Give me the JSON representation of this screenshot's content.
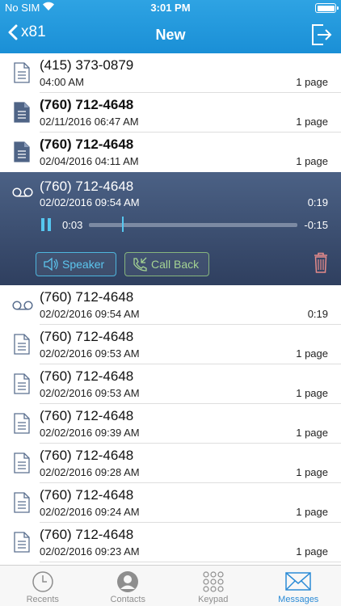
{
  "status": {
    "carrier": "No SIM",
    "time": "3:01 PM"
  },
  "nav": {
    "back_label": "x81",
    "title": "New"
  },
  "messages": [
    {
      "number": "(415) 373-0879",
      "date": "04:00 AM",
      "meta": "1 page",
      "type": "fax",
      "unread": false
    },
    {
      "number": "(760) 712-4648",
      "date": "02/11/2016 06:47 AM",
      "meta": "1 page",
      "type": "fax",
      "unread": true
    },
    {
      "number": "(760) 712-4648",
      "date": "02/04/2016 04:11 AM",
      "meta": "1 page",
      "type": "fax",
      "unread": true
    }
  ],
  "voicemail": {
    "number": "(760) 712-4648",
    "date": "02/02/2016 09:54 AM",
    "duration": "0:19",
    "elapsed": "0:03",
    "remaining": "-0:15",
    "progress": 0.16,
    "speaker_label": "Speaker",
    "callback_label": "Call Back"
  },
  "messages2": [
    {
      "number": "(760) 712-4648",
      "date": "02/02/2016 09:54 AM",
      "meta": "0:19",
      "type": "voicemail"
    },
    {
      "number": "(760) 712-4648",
      "date": "02/02/2016 09:53 AM",
      "meta": "1 page",
      "type": "fax"
    },
    {
      "number": "(760) 712-4648",
      "date": "02/02/2016 09:53 AM",
      "meta": "1 page",
      "type": "fax"
    },
    {
      "number": "(760) 712-4648",
      "date": "02/02/2016 09:39 AM",
      "meta": "1 page",
      "type": "fax"
    },
    {
      "number": "(760) 712-4648",
      "date": "02/02/2016 09:28 AM",
      "meta": "1 page",
      "type": "fax"
    },
    {
      "number": "(760) 712-4648",
      "date": "02/02/2016 09:24 AM",
      "meta": "1 page",
      "type": "fax"
    },
    {
      "number": "(760) 712-4648",
      "date": "02/02/2016 09:23 AM",
      "meta": "1 page",
      "type": "fax"
    }
  ],
  "tabs": [
    {
      "label": "Recents",
      "icon": "clock-icon",
      "active": false
    },
    {
      "label": "Contacts",
      "icon": "contact-icon",
      "active": false
    },
    {
      "label": "Keypad",
      "icon": "keypad-icon",
      "active": false
    },
    {
      "label": "Messages",
      "icon": "envelope-icon",
      "active": true
    }
  ],
  "colors": {
    "header": "#1a8fd6",
    "accent": "#56c7f0",
    "active_tab": "#2b8bd6",
    "voicemail_bg": "#3d506f"
  }
}
